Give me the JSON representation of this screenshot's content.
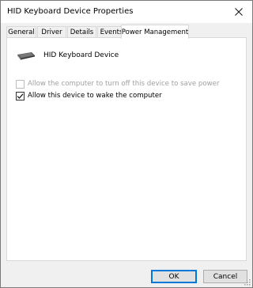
{
  "window": {
    "title": "HID Keyboard Device Properties"
  },
  "titlebar": {
    "close_icon": "close-icon"
  },
  "tabs": [
    {
      "label": "General",
      "active": false
    },
    {
      "label": "Driver",
      "active": false
    },
    {
      "label": "Details",
      "active": false
    },
    {
      "label": "Events",
      "active": false
    },
    {
      "label": "Power Management",
      "active": true
    }
  ],
  "device": {
    "name": "HID Keyboard Device",
    "icon": "keyboard-icon"
  },
  "options": [
    {
      "label": "Allow the computer to turn off this device to save power",
      "checked": false,
      "enabled": false
    },
    {
      "label": "Allow this device to wake the computer",
      "checked": true,
      "enabled": true
    }
  ],
  "buttons": {
    "ok_label": "OK",
    "cancel_label": "Cancel"
  },
  "colors": {
    "accent": "#0078d7",
    "disabled_text": "#a0a0a0",
    "dialog_bg": "#f0f0f0"
  }
}
